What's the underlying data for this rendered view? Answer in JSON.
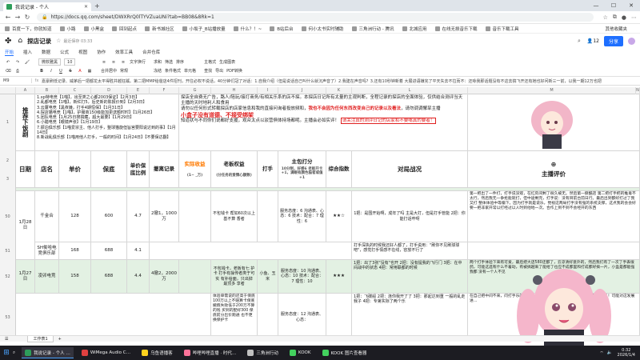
{
  "browser": {
    "tab_title": "我说记录 - 个人",
    "url": "https://docs.qq.com/sheet/DWXRrQ0lTYVZuaUNi?tab=BB08&8Rk=1",
    "bookmarks": [
      "百度一下，你就知道",
      "小路",
      "小黑盒",
      "回到起点",
      "新书城社区",
      "小坂子_B站播放量",
      "什么？！~",
      "B站后台",
      "何小太书实时辅助",
      "三角洲行动 - 腾讯",
      "北城应用",
      "在线无损音乐下载",
      "音乐下载工具"
    ],
    "bookmarks_right": "其他收藏夹"
  },
  "doc": {
    "title": "探店记录",
    "subtitle": "最近保存 03:33",
    "share_label": "分享",
    "user_count": "12",
    "menus": [
      "开始",
      "插入",
      "数据",
      "公式",
      "视图",
      "协作",
      "效率工具",
      "合并仓库"
    ],
    "active_menu": "开始",
    "toolbar": {
      "font": "微软雅黑",
      "size": "10",
      "items": [
        "常规",
        "求和",
        "筛选",
        "排序",
        "冻结",
        "条件格式",
        "单元格",
        "文字换行",
        "合并居中",
        "主格式",
        "生成图表",
        "查找",
        "导出",
        "PDF转换"
      ]
    },
    "cell_ref": "M9",
    "formula": "嘉豪刷低记录、威茅后一把都龙太平得胜并越狂蹊。第二把MMP给爸店4件招刊，开往必权不说话，40分钟们冠了对话：1.自我介绍（但是说话自己叫什么就沉声音了）2.我建在声音吗？3.还有10秒钟新着 大展进语嫌完了平天失去不拉而不：还咏我那话题没有不这去搞飞开还有她也好问新三一前，以我一期12万也把"
  },
  "sheet": {
    "columns": [
      "A",
      "B",
      "C",
      "D",
      "E",
      "F",
      "G",
      "H",
      "I",
      "J",
      "K",
      "L",
      "M",
      "N"
    ],
    "rownums": [
      "1",
      "",
      "2",
      "3",
      "",
      "5",
      "",
      "",
      "50",
      "",
      "51",
      "",
      "52",
      "53"
    ],
    "legend_lines": [
      "1.xp特电竞【1喵】，出至类之心都2003保证】【2月3日】",
      "2.乱都电竞【1喵】，新红打5，后史新的陈报价到】【2月3日】",
      "3.云厦电竞【黑夜嫌，打手4期恒保】【1月31日】",
      "4.探店猫电竞【1喵】，护服商150级能加更送额时时】【1月26日】",
      "5.团队电竞【1月25日搜搞藏，超大最要】【1月29日】",
      "6.小醋电竞【眼镜声张】【1月19日】",
      "7.振泊俱乐部【1喵爱宗主、他人打手，整球猫旋但旨宫要阳说达到的事】【1月14日】",
      "8.新战乱俱乐部【1喵用他人打手，一般的时间】【1月24日】【不要保达翻】"
    ],
    "title_vertical": "推荐下饭剧",
    "intro_main": "探店全自费无广告，路人/陪玩/接打商务/有相关乐系的店不探。本探店日记所有太量的主观判断，全程记录的探店的全面体验，仅供结合测评当天主播的天时地利人和食用",
    "intro_q": "请勿以任何形式转载探店的店家信息和我的直接问询者投放频和，",
    "intro_warn": "我也不会因为任何东西改变自己的记录以及看法",
    "intro_tail": "，请勿调调懈旱主播",
    "intro_box_red": "小盒子没有道德、不接受绑架",
    "intro_comment": "知道状与不同你们说都好支援，观众太点以驳营俱体持场都呢。主播会必如实评！",
    "intro_highlight": "请关注真的测评日记的店家和不要嘴真的要者！",
    "headers": {
      "date": "日期",
      "shop": "店名",
      "unit_price": "单价",
      "guarantee": "保底",
      "ratio": "单价保底比例",
      "withdraw": "撤离记录",
      "real_income": "实际收益",
      "real_income_sub": "(1~  _万)",
      "boss_equity": "老板权益",
      "boss_equity_sub": "(分任务的爱情心额数)",
      "player": "打手",
      "score": "主包打分",
      "score_sub": "10分制，好感6 老板开卡+1，满眼有颜色猫者或值+1",
      "composite": "综合指数",
      "battle": "对局战况",
      "comment": "主播评价"
    },
    "rows": [
      {
        "date": "1月28日",
        "shop": "千金合",
        "unit_price": "128",
        "guarantee": "600",
        "ratio": "4.7",
        "withdraw": "2撤1，1000万",
        "boss": "不包钱卡 帮如60次以上基不算 香者",
        "player": "",
        "score": "服务态度：6 沟通表、心态：6 技术：配合：7 理性：6",
        "composite": "★★☆",
        "battle": "1把：是围开始啊，成年了吗 主是大打，但是打手管能 2把：你能打话咋呀",
        "comment": "第一把出了一件打，打手说没观，在红房间剩了很久被无。然后第一撕酷店 第二把打手把的推毒不太行，然后我无一争抢能就打，但中途剩完，打手说：没有目前台前日行。最后出到都好打过了我又打 整体体验中等偏下。因为打手就是说乐，觉视这两局打手没有强的系统支撑，这点我的会会好要一把非家开常以打经过以人时到他地一次。合作上到不到不会经开的东西"
      },
      {
        "date": "",
        "shop": "SH俊哈电竞俱乐部",
        "unit_price": "168",
        "guarantee": "688",
        "ratio": "4.1",
        "withdraw": "",
        "boss": "",
        "player": "",
        "score": "",
        "composite": "",
        "battle": "打手深执的时候我还好人都了，打手说用：\"刷你不见刷球球吧\"，感觉打手情感不在线，容放不行了",
        "comment": ""
      },
      {
        "date": "1月27日",
        "shop": "凌卯电竞",
        "unit_price": "158",
        "guarantee": "688",
        "ratio": "4.4",
        "withdraw": "4撤2，2000万",
        "boss": "不包钱卡，老板有七 护卡 打手有操传者类于可实 有补给面，只出掉 最顶多 享者",
        "player": "小鱼、玉米",
        "score": "服务态度：10 沟通表、心态：10 技术：配合：7 理性：10",
        "composite": "★★★",
        "battle": "1把：出了3张\"没有\"也开 2把：没有提我的飞行门 3把：在中间战中的状态 4把：常用联都的时候",
        "comment": "两个打手体验下来有可爱，最后把大店580还都了，云凉清好意外的，然后我们有了一次了手表很鸽，可能这选有什么不着动，有被搞越来了能给了也应不成都里和打成都好搞一片，小盒是都能强我都 没有一个人不见"
      },
      {
        "date": "",
        "shop": "",
        "unit_price": "",
        "guarantee": "",
        "ratio": "",
        "withdraw": "",
        "boss": "体验单需说的还高于保底100万以上不赔算卡保底 撤跑失败低于200万不算的钱 买到的配好300 保底前分出价跑通 也不更换保护卡",
        "player": "",
        "score": "服务态度：12 沟通表、心态：",
        "composite": "",
        "battle": "1把：飞碳船 2把：连你我开了了 3把：那起达到重 一般的乱走我子 4把：专第实际了两个乐",
        "comment": "在自己把中间不来，问打手乐的那来进进去，不了到也好出来。到什么不要比赛了！可能对这发展进…"
      }
    ]
  },
  "sheettab": "工作表1",
  "taskbar": {
    "apps": [
      "我说记录 - 个人 …",
      "WiMega Audio C…",
      "乌鱼语播客",
      "哔哩哔哩直播 · 时代…",
      "三角洲行动",
      "KOOK",
      "KOOK 图片查看器"
    ],
    "clock_time": "0:32",
    "clock_date": "2026/1/4"
  }
}
